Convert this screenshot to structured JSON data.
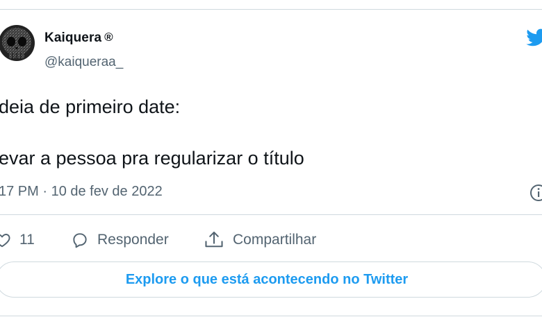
{
  "user": {
    "display_name": "Kaiquera",
    "registered_mark": "®",
    "handle": "@kaiqueraa_"
  },
  "tweet": {
    "line1": "deia de primeiro date:",
    "line2": "evar a pessoa pra regularizar o título",
    "timestamp": "17 PM · 10 de fev de 2022"
  },
  "actions": {
    "like_count": "11",
    "reply_label": "Responder",
    "share_label": "Compartilhar"
  },
  "explore": {
    "label": "Explore o que está acontecendo no Twitter"
  },
  "icons": {
    "brand": "twitter-bird-icon",
    "info": "info-icon",
    "like": "heart-icon",
    "reply": "speech-bubble-icon",
    "share": "share-upload-icon"
  },
  "colors": {
    "twitter_blue": "#1d9bf0",
    "text": "#0f1419",
    "secondary_text": "#536471",
    "border": "#cfd9de"
  }
}
